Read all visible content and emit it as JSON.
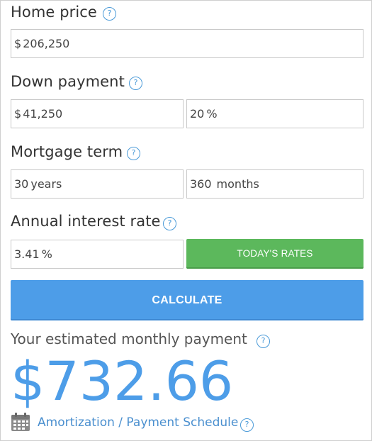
{
  "home_price": {
    "label": "Home price",
    "help_icon": "?",
    "currency": "$",
    "value": "206,250"
  },
  "down_payment": {
    "label": "Down payment",
    "help_icon": "?",
    "currency": "$",
    "amount": "41,250",
    "percent": "20",
    "percent_unit": "%"
  },
  "mortgage_term": {
    "label": "Mortgage term",
    "help_icon": "?",
    "years_value": "30",
    "years_unit": "years",
    "months_value": "360",
    "months_unit": "months"
  },
  "interest_rate": {
    "label": "Annual interest rate",
    "help_icon": "?",
    "value": "3.41",
    "unit": "%",
    "rates_button": "TODAY'S RATES"
  },
  "calculate_button": "CALCULATE",
  "result": {
    "label": "Your estimated monthly payment",
    "help_icon": "?",
    "amount": "$732.66"
  },
  "amortization": {
    "icon": "calendar-icon",
    "link": "Amortization / Payment Schedule",
    "help_icon": "?"
  },
  "colors": {
    "accent_blue": "#4d9de8",
    "green": "#5cb85c",
    "help_blue": "#4a9ad8",
    "text_dark": "#333333"
  }
}
